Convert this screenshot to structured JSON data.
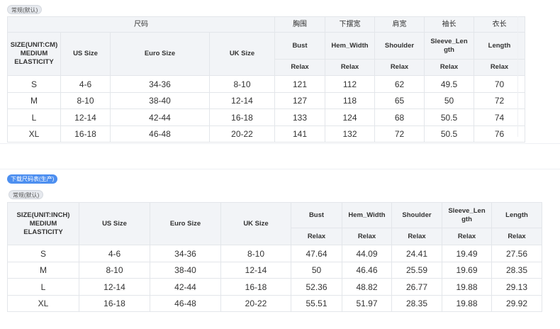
{
  "tags": {
    "default_top": "常规(默认)",
    "download": "下载尺码表(生产)",
    "default_bottom": "常规(默认)"
  },
  "table_cm": {
    "group_header": "尺码",
    "cn_headers": [
      "胸围",
      "下摆宽",
      "肩宽",
      "袖长",
      "衣长"
    ],
    "size_label": [
      "SIZE(UNIT:CM)",
      "MEDIUM",
      "ELASTICITY"
    ],
    "col_headers": [
      "US Size",
      "Euro Size",
      "UK Size"
    ],
    "measure_headers": [
      "Bust",
      "Hem_Width",
      "Shoulder",
      "Sleeve_Length",
      "Length"
    ],
    "fit": "Relax",
    "rows": [
      [
        "S",
        "4-6",
        "34-36",
        "8-10",
        "121",
        "112",
        "62",
        "49.5",
        "70"
      ],
      [
        "M",
        "8-10",
        "38-40",
        "12-14",
        "127",
        "118",
        "65",
        "50",
        "72"
      ],
      [
        "L",
        "12-14",
        "42-44",
        "16-18",
        "133",
        "124",
        "68",
        "50.5",
        "74"
      ],
      [
        "XL",
        "16-18",
        "46-48",
        "20-22",
        "141",
        "132",
        "72",
        "50.5",
        "76"
      ]
    ]
  },
  "table_inch": {
    "size_label": [
      "SIZE(UNIT:INCH)",
      "MEDIUM",
      "ELASTICITY"
    ],
    "col_headers": [
      "US Size",
      "Euro Size",
      "UK Size"
    ],
    "measure_headers": [
      "Bust",
      "Hem_Width",
      "Shoulder",
      "Sleeve_Length",
      "Length"
    ],
    "fit": "Relax",
    "rows": [
      [
        "S",
        "4-6",
        "34-36",
        "8-10",
        "47.64",
        "44.09",
        "24.41",
        "19.49",
        "27.56"
      ],
      [
        "M",
        "8-10",
        "38-40",
        "12-14",
        "50",
        "46.46",
        "25.59",
        "19.69",
        "28.35"
      ],
      [
        "L",
        "12-14",
        "42-44",
        "16-18",
        "52.36",
        "48.82",
        "26.77",
        "19.88",
        "29.13"
      ],
      [
        "XL",
        "16-18",
        "46-48",
        "20-22",
        "55.51",
        "51.97",
        "28.35",
        "19.88",
        "29.92"
      ]
    ]
  }
}
